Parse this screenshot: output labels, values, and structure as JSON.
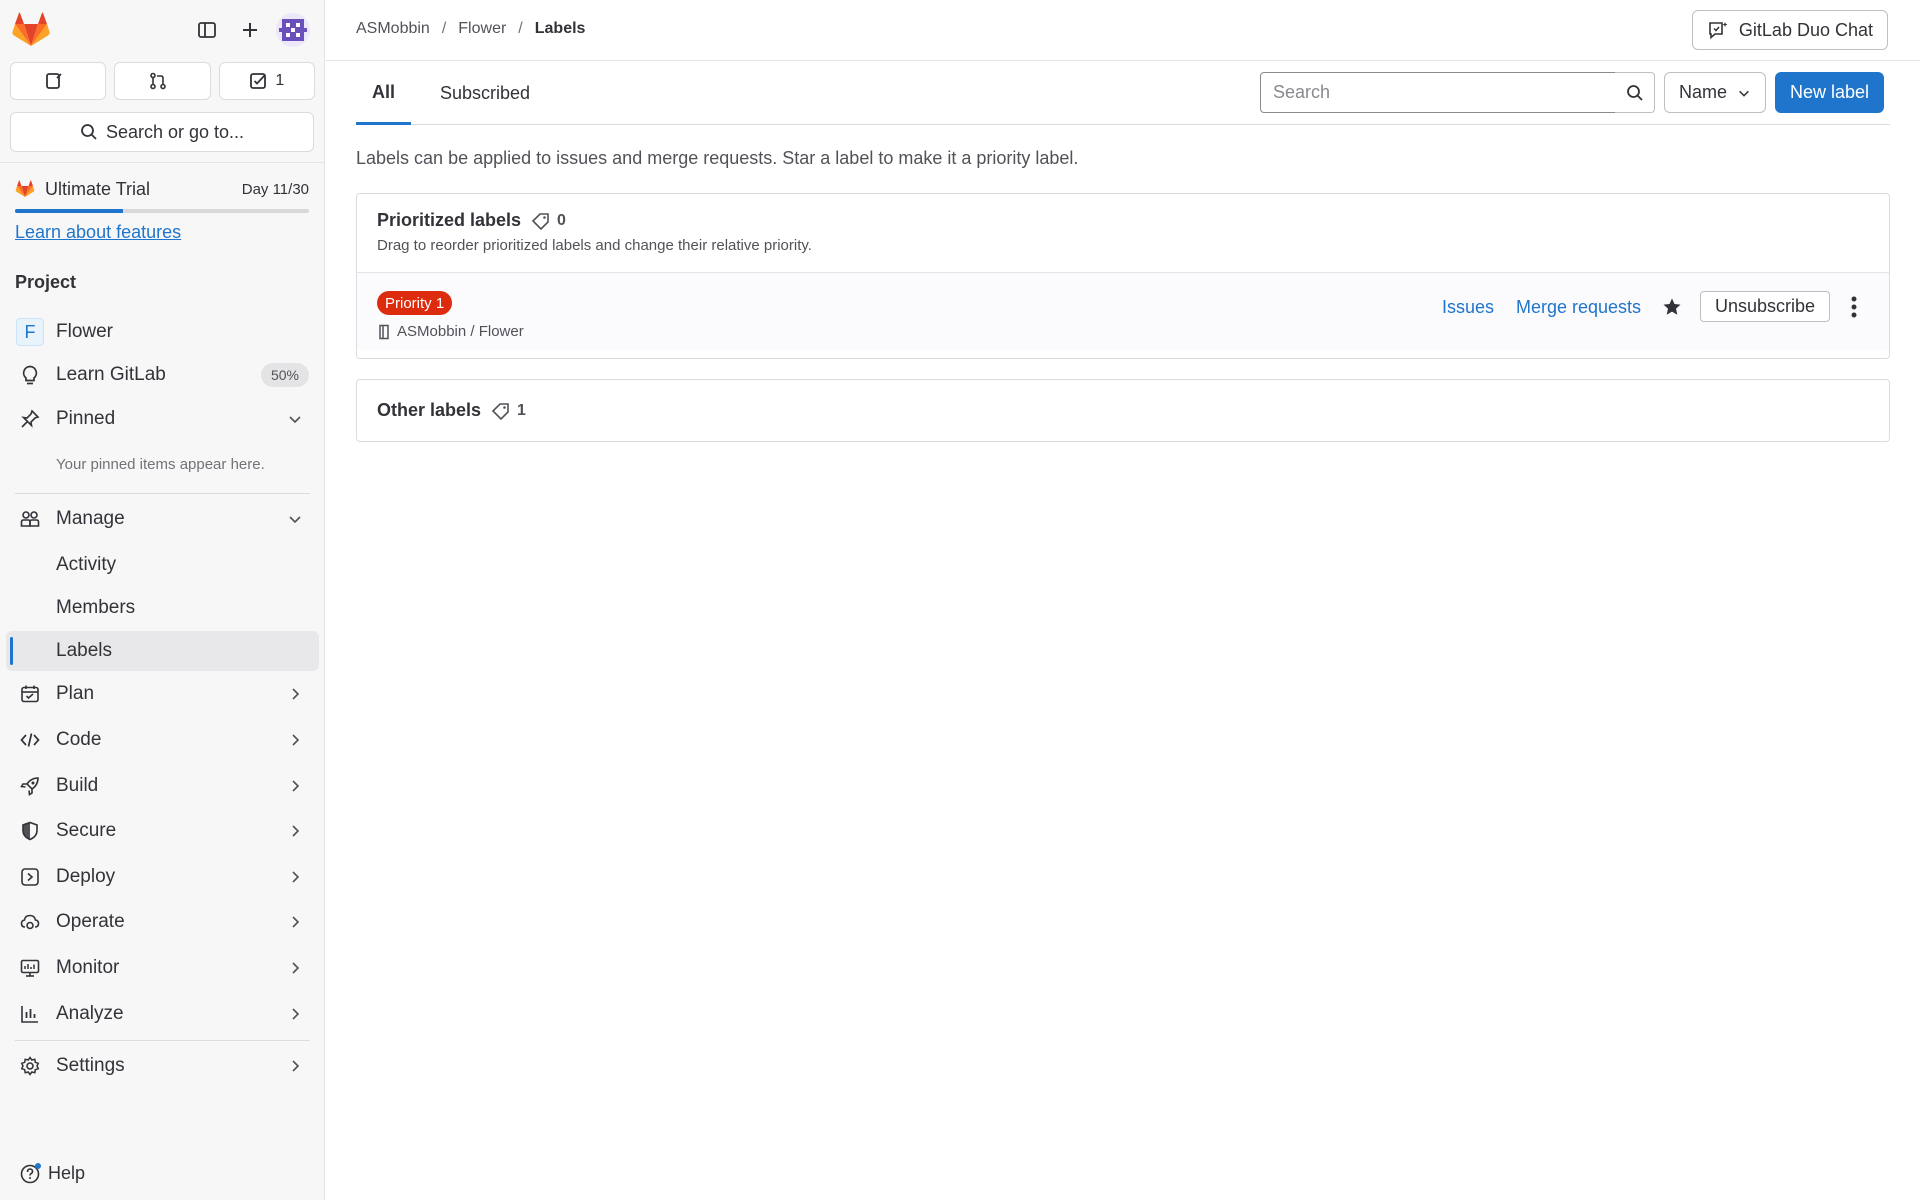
{
  "sidebar": {
    "counts": {
      "issues": "",
      "merge_requests": "",
      "todos": "1"
    },
    "search_label": "Search or go to...",
    "trial": {
      "name": "Ultimate Trial",
      "day": "Day 11/30",
      "progress": 0.367,
      "learn_link": "Learn about features"
    },
    "section": "Project",
    "project": {
      "letter": "F",
      "name": "Flower"
    },
    "learn_gitlab": {
      "label": "Learn GitLab",
      "badge": "50%"
    },
    "pinned": {
      "label": "Pinned",
      "hint": "Your pinned items appear here."
    },
    "manage": {
      "label": "Manage",
      "items": [
        "Activity",
        "Members",
        "Labels"
      ]
    },
    "groups": [
      "Plan",
      "Code",
      "Build",
      "Secure",
      "Deploy",
      "Operate",
      "Monitor",
      "Analyze"
    ],
    "settings": "Settings",
    "help": "Help"
  },
  "topbar": {
    "breadcrumb": [
      "ASMobbin",
      "Flower",
      "Labels"
    ],
    "duo_chat": "GitLab Duo Chat"
  },
  "tabs": {
    "all": "All",
    "subscribed": "Subscribed"
  },
  "toolbar": {
    "search_placeholder": "Search",
    "sort": "Name",
    "new_label": "New label"
  },
  "description": "Labels can be applied to issues and merge requests. Star a label to make it a priority label.",
  "prioritized": {
    "title": "Prioritized labels",
    "count": "0",
    "subtitle": "Drag to reorder prioritized labels and change their relative priority.",
    "label": {
      "name": "Priority 1",
      "color": "#dd2b0e",
      "path": "ASMobbin / Flower",
      "issues_link": "Issues",
      "mr_link": "Merge requests",
      "unsubscribe": "Unsubscribe"
    }
  },
  "other": {
    "title": "Other labels",
    "count": "1"
  },
  "colors": {
    "accent": "#1f75cb",
    "label_red": "#dd2b0e"
  }
}
